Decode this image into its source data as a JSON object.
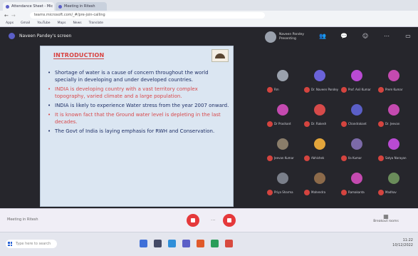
{
  "browser": {
    "tabs": [
      {
        "title": "Attendance Sheet - Mic",
        "active": true
      },
      {
        "title": "Meeting in Ritesh",
        "active": false
      }
    ],
    "address": "teams.microsoft.com/_#/pre-join-calling",
    "bookmarks": [
      "Apps",
      "Gmail",
      "YouTube",
      "Maps",
      "News",
      "Translate"
    ]
  },
  "meeting": {
    "title": "Naveen Pandey's screen",
    "presenter_label": "Naveen Pandey",
    "presenter_status": "Presenting",
    "controls": [
      {
        "name": "participants-icon",
        "glyph": "👥"
      },
      {
        "name": "chat-icon",
        "glyph": "💬"
      },
      {
        "name": "reactions-icon",
        "glyph": "☺"
      },
      {
        "name": "more-icon",
        "glyph": "⋯"
      },
      {
        "name": "camera-icon",
        "glyph": "▭"
      },
      {
        "name": "mic-icon",
        "glyph": "🎙"
      }
    ]
  },
  "slide": {
    "title": "INTRODUCTION",
    "bullets": [
      {
        "text": "Shortage of water is a cause of concern throughout the world specially in developing and under developed countries.",
        "color": "#1f2f66"
      },
      {
        "text": "INDIA is developing country with a vast territory complex topography, varied climate and a large population.",
        "color": "#d8484a"
      },
      {
        "text": "INDIA is likely to experience Water stress from the year 2007 onward.",
        "color": "#1f2f66"
      },
      {
        "text": "It is known fact that the Ground water level is depleting in the last decades.",
        "color": "#d8484a"
      },
      {
        "text": "The Govt of India is laying emphasis for RWH and Conservation.",
        "color": "#1f2f66"
      }
    ]
  },
  "participants": [
    {
      "name": "Rm",
      "color": "#9aa1ad"
    },
    {
      "name": "Dr. Naveen Pandey",
      "color": "#6b63d9"
    },
    {
      "name": "Prof. Anil Kumar",
      "color": "#b94ad3"
    },
    {
      "name": "Prem Kumar",
      "color": "#c44ab0"
    },
    {
      "name": "Dr Prashant",
      "color": "#c44ab0"
    },
    {
      "name": "Dr. Rakesh",
      "color": "#d64a4a"
    },
    {
      "name": "Chandrakant",
      "color": "#5b5fc7"
    },
    {
      "name": "Dr. Jeevan",
      "color": "#c44ab0"
    },
    {
      "name": "Jeevan Kumar",
      "color": "#8a7d6a"
    },
    {
      "name": "Abhishek",
      "color": "#e3a53b"
    },
    {
      "name": "Ila Kumar",
      "color": "#7c6aa8"
    },
    {
      "name": "Satya Narayan",
      "color": "#b94ad3"
    },
    {
      "name": "Priya Sharma",
      "color": "#7a7f8a"
    },
    {
      "name": "Mahendra",
      "color": "#8c6a4a"
    },
    {
      "name": "Ramakanta",
      "color": "#c44ab0"
    },
    {
      "name": "Madhav",
      "color": "#6a8c5a"
    }
  ],
  "footer": {
    "status": "Meeting in Ritesh",
    "more": "···",
    "right_label": "Breakout rooms"
  },
  "taskbar": {
    "search_placeholder": "Type here to search",
    "time": "11:22",
    "date": "10/12/2022",
    "icon_colors": [
      "#3f6fd8",
      "#444a66",
      "#2f8fd9",
      "#5b5fc7",
      "#e05a2b",
      "#2a9d5a",
      "#d84a3f"
    ]
  }
}
